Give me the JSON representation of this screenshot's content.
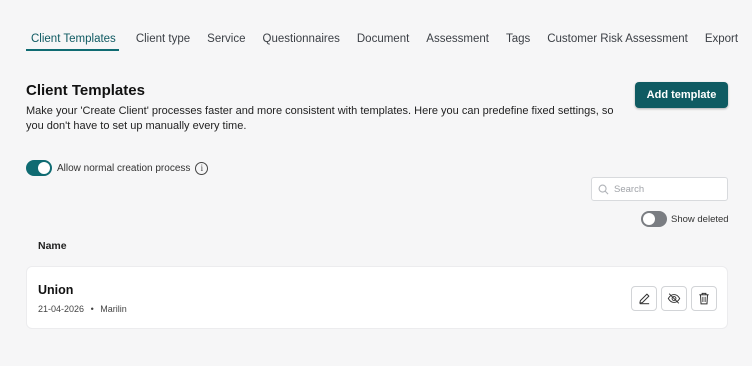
{
  "tabs": [
    {
      "label": "Client Templates",
      "active": true
    },
    {
      "label": "Client type"
    },
    {
      "label": "Service"
    },
    {
      "label": "Questionnaires"
    },
    {
      "label": "Document"
    },
    {
      "label": "Assessment"
    },
    {
      "label": "Tags"
    },
    {
      "label": "Customer Risk Assessment"
    },
    {
      "label": "Export"
    }
  ],
  "page": {
    "title": "Client Templates",
    "description": "Make your 'Create Client' processes faster and more consistent with templates. Here you can predefine fixed settings, so you don't have to set up manually every time.",
    "add_button": "Add template"
  },
  "allow_normal": {
    "label": "Allow normal creation process",
    "enabled": true
  },
  "search": {
    "placeholder": "Search"
  },
  "show_deleted": {
    "label": "Show deleted",
    "enabled": false
  },
  "table": {
    "column_name": "Name",
    "rows": [
      {
        "name": "Union",
        "date": "21-04-2026",
        "separator": "•",
        "author": "Marilin"
      }
    ]
  },
  "colors": {
    "accent": "#0f5b62",
    "background": "#f6f6f7"
  },
  "icons": {
    "info": "info-icon",
    "search": "search-icon",
    "edit": "pencil-icon",
    "hide": "eye-off-icon",
    "delete": "trash-icon"
  }
}
